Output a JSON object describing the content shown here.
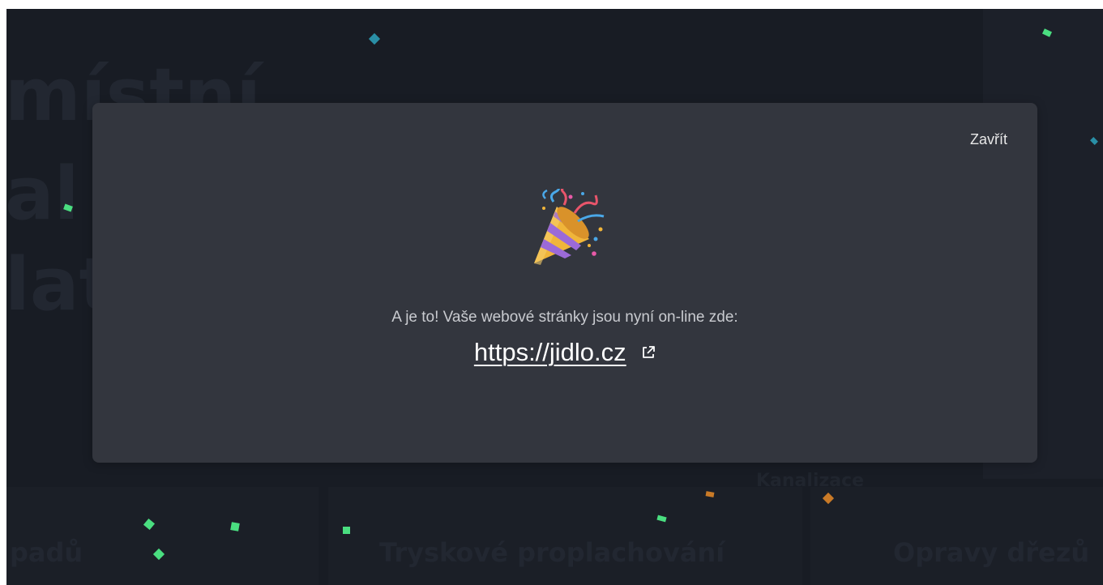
{
  "modal": {
    "close_label": "Zavřít",
    "message": "A je to! Vaše webové stránky jsou nyní on-line zde:",
    "link_text": "https://jidlo.cz",
    "link_href": "https://jidlo.cz",
    "celebration_icon": "party-popper-icon",
    "external_icon": "external-link-icon"
  },
  "background": {
    "hero_lines": [
      "místní",
      "al",
      "lat"
    ],
    "bottom_labels": [
      "padů",
      "Tryskové proplachování",
      "Opravy dřezů"
    ],
    "mid_label": "Kanalizace"
  },
  "colors": {
    "backdrop": "#181c24",
    "modal": "#33363e",
    "confetti_green": "#4ade80",
    "confetti_teal": "#2a8fa6",
    "confetti_orange": "#c97a27"
  }
}
